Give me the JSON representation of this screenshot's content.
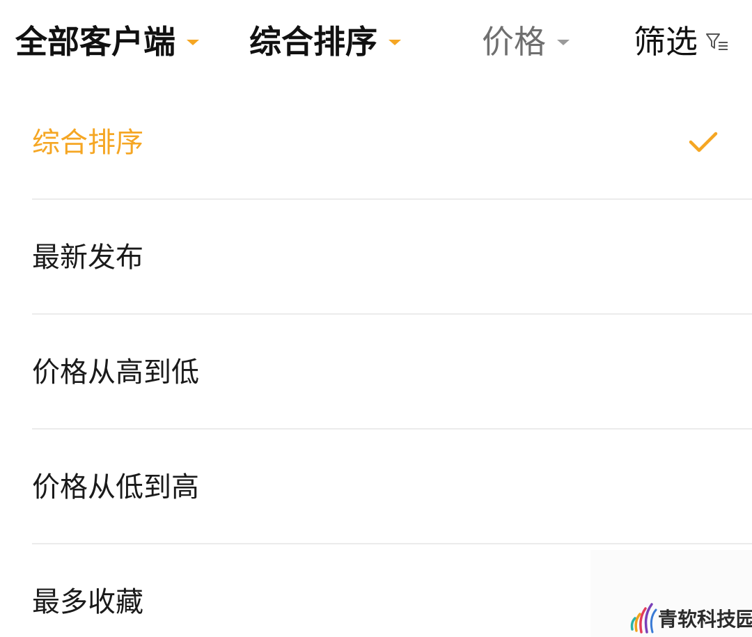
{
  "filter_bar": {
    "client": {
      "label": "全部客户端"
    },
    "sort": {
      "label": "综合排序"
    },
    "price": {
      "label": "价格"
    },
    "filter": {
      "label": "筛选",
      "icon": "filter-funnel-icon"
    }
  },
  "sort_options": [
    {
      "label": "综合排序",
      "selected": true
    },
    {
      "label": "最新发布",
      "selected": false
    },
    {
      "label": "价格从高到低",
      "selected": false
    },
    {
      "label": "价格从低到高",
      "selected": false
    },
    {
      "label": "最多收藏",
      "selected": false
    }
  ],
  "watermark": {
    "text": "青软科技园"
  },
  "colors": {
    "accent": "#f5a623",
    "text": "#111111",
    "muted": "#6f6f6f",
    "divider": "#ebebeb"
  }
}
